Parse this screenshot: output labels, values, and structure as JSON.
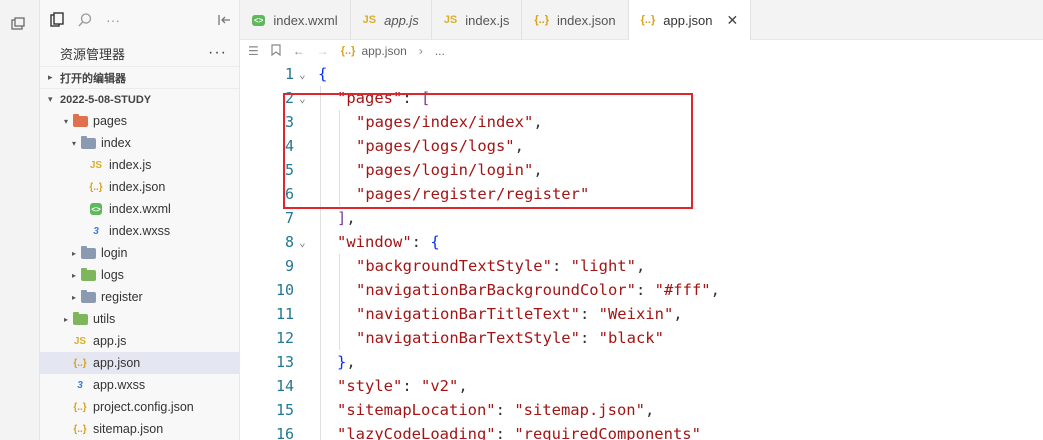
{
  "sidebar": {
    "title": "资源管理器",
    "more": "···",
    "sections": {
      "open_editors": "打开的编辑器",
      "project": "2022-5-08-STUDY"
    },
    "tree": [
      {
        "label": "pages",
        "depth": 0,
        "kind": "folder",
        "open": true,
        "color": "#e0704e"
      },
      {
        "label": "index",
        "depth": 1,
        "kind": "folder",
        "open": true,
        "color": "#8a9bb1"
      },
      {
        "label": "index.js",
        "depth": 2,
        "kind": "js"
      },
      {
        "label": "index.json",
        "depth": 2,
        "kind": "json"
      },
      {
        "label": "index.wxml",
        "depth": 2,
        "kind": "wxml"
      },
      {
        "label": "index.wxss",
        "depth": 2,
        "kind": "wxss"
      },
      {
        "label": "login",
        "depth": 1,
        "kind": "folder",
        "open": false,
        "color": "#8a9bb1"
      },
      {
        "label": "logs",
        "depth": 1,
        "kind": "folder",
        "open": false,
        "color": "#7fb65b"
      },
      {
        "label": "register",
        "depth": 1,
        "kind": "folder",
        "open": false,
        "color": "#8a9bb1"
      },
      {
        "label": "utils",
        "depth": 0,
        "kind": "folder",
        "open": false,
        "color": "#7fb65b"
      },
      {
        "label": "app.js",
        "depth": 0,
        "kind": "js"
      },
      {
        "label": "app.json",
        "depth": 0,
        "kind": "json",
        "selected": true
      },
      {
        "label": "app.wxss",
        "depth": 0,
        "kind": "wxss"
      },
      {
        "label": "project.config.json",
        "depth": 0,
        "kind": "json"
      },
      {
        "label": "sitemap.json",
        "depth": 0,
        "kind": "json"
      }
    ]
  },
  "tabs": [
    {
      "label": "index.wxml",
      "kind": "wxml",
      "italic": false
    },
    {
      "label": "app.js",
      "kind": "js",
      "italic": true
    },
    {
      "label": "index.js",
      "kind": "js",
      "italic": false
    },
    {
      "label": "index.json",
      "kind": "json",
      "italic": false
    },
    {
      "label": "app.json",
      "kind": "json",
      "italic": false,
      "active": true
    }
  ],
  "breadcrumb": {
    "file": "app.json",
    "rest": "..."
  },
  "editor": {
    "lines": [
      {
        "n": "1",
        "fold": true,
        "indent": 0,
        "code": "{"
      },
      {
        "n": "2",
        "fold": true,
        "indent": 1,
        "code": "\"pages\": ["
      },
      {
        "n": "3",
        "indent": 2,
        "code": "\"pages/index/index\","
      },
      {
        "n": "4",
        "indent": 2,
        "code": "\"pages/logs/logs\","
      },
      {
        "n": "5",
        "indent": 2,
        "code": "\"pages/login/login\","
      },
      {
        "n": "6",
        "indent": 2,
        "code": "\"pages/register/register\""
      },
      {
        "n": "7",
        "indent": 1,
        "code": "],"
      },
      {
        "n": "8",
        "fold": true,
        "indent": 1,
        "code": "\"window\": {"
      },
      {
        "n": "9",
        "indent": 2,
        "code": "\"backgroundTextStyle\": \"light\","
      },
      {
        "n": "10",
        "indent": 2,
        "code": "\"navigationBarBackgroundColor\": \"#fff\","
      },
      {
        "n": "11",
        "indent": 2,
        "code": "\"navigationBarTitleText\": \"Weixin\","
      },
      {
        "n": "12",
        "indent": 2,
        "code": "\"navigationBarTextStyle\": \"black\""
      },
      {
        "n": "13",
        "indent": 1,
        "code": "},"
      },
      {
        "n": "14",
        "indent": 1,
        "code": "\"style\": \"v2\","
      },
      {
        "n": "15",
        "indent": 1,
        "code": "\"sitemapLocation\": \"sitemap.json\","
      },
      {
        "n": "16",
        "indent": 1,
        "code": "\"lazyCodeLoading\": \"requiredComponents\""
      }
    ]
  },
  "colors": {
    "highlight": "#e0262d",
    "key": "#a31515",
    "line_number": "#237893"
  }
}
